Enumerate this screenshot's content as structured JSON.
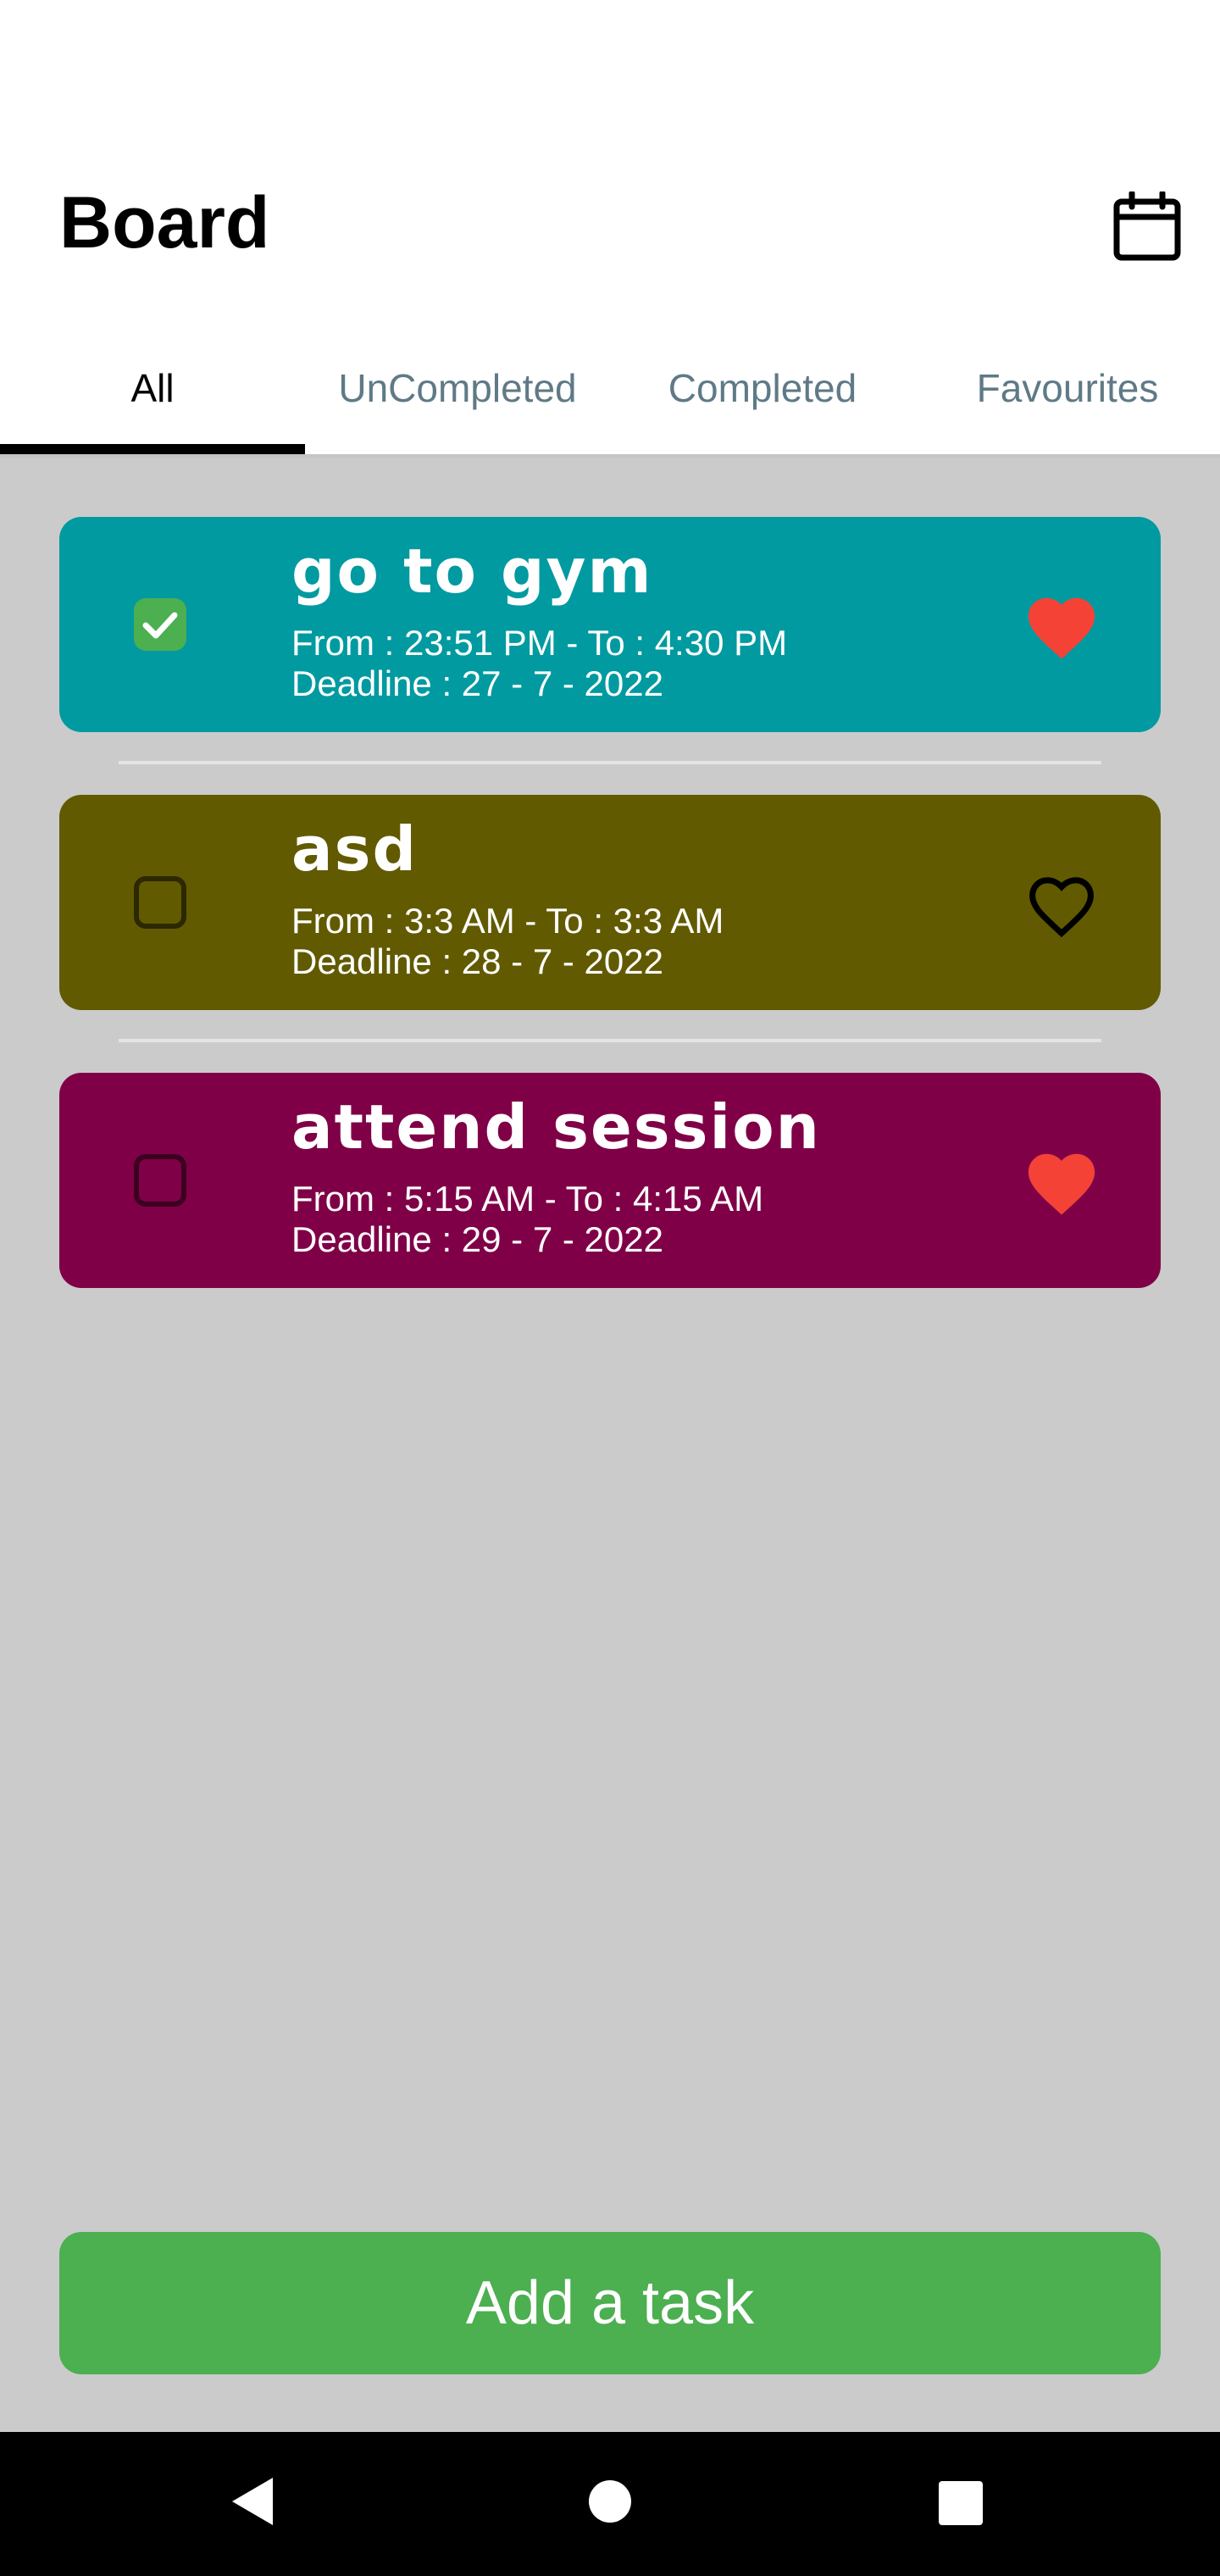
{
  "header": {
    "title": "Board",
    "calendar_icon": "calendar-icon"
  },
  "tabs": [
    {
      "label": "All",
      "active": true
    },
    {
      "label": "UnCompleted",
      "active": false
    },
    {
      "label": "Completed",
      "active": false
    },
    {
      "label": "Favourites",
      "active": false
    }
  ],
  "tasks": [
    {
      "title": "go to gym",
      "time": "From : 23:51 PM - To : 4:30 PM",
      "deadline": "Deadline : 27 - 7 - 2022",
      "color": "#009aa0",
      "completed": true,
      "favourite": true
    },
    {
      "title": "asd",
      "time": "From : 3:3 AM - To : 3:3 AM",
      "deadline": "Deadline : 28 - 7 - 2022",
      "color": "#625a01",
      "completed": false,
      "favourite": false
    },
    {
      "title": "attend session",
      "time": "From : 5:15 AM - To : 4:15 AM",
      "deadline": "Deadline : 29 - 7 - 2022",
      "color": "#800047",
      "completed": false,
      "favourite": true
    }
  ],
  "add_button": {
    "label": "Add a task",
    "color": "#4caf50"
  },
  "colors": {
    "board_background": "#cbcbcb",
    "heart_filled": "#f44336",
    "inactive_tab": "#5f7a86"
  },
  "nav": {
    "back_icon": "back-triangle-icon",
    "home_icon": "home-circle-icon",
    "recents_icon": "recents-square-icon"
  }
}
